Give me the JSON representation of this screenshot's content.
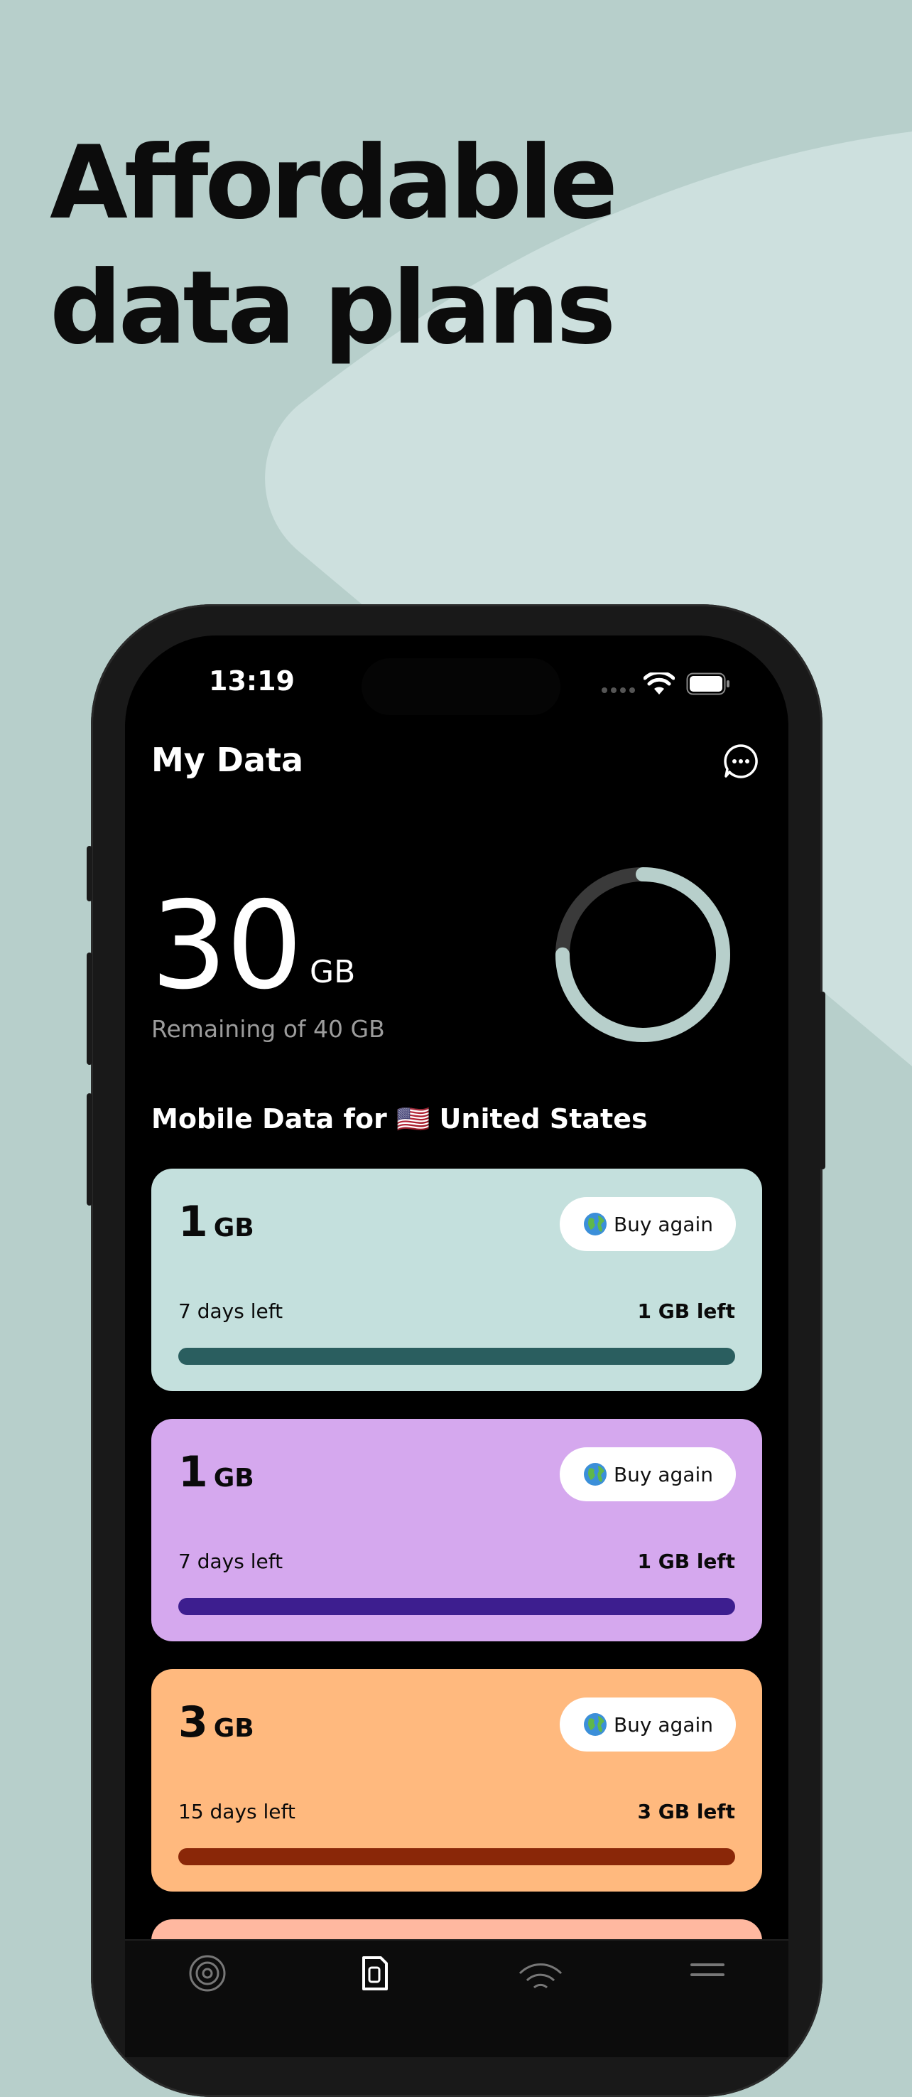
{
  "headline": [
    "Affordable",
    "data plans"
  ],
  "status_bar": {
    "time": "13:19"
  },
  "app": {
    "title": "My Data",
    "remaining_value": "30",
    "remaining_unit": "GB",
    "remaining_caption": "Remaining of 40 GB",
    "remaining_fraction": 0.75,
    "section_title": "Mobile Data for 🇺🇸 United States"
  },
  "plans": [
    {
      "amount": "1",
      "unit": "GB",
      "buy_label": "Buy again",
      "days_left": "7 days left",
      "data_left": "1 GB left",
      "progress": 1.0,
      "card_color": "#c4e0dd",
      "bar_color": "#2a5e5f"
    },
    {
      "amount": "1",
      "unit": "GB",
      "buy_label": "Buy again",
      "days_left": "7 days left",
      "data_left": "1 GB left",
      "progress": 1.0,
      "card_color": "#d5a8ee",
      "bar_color": "#3d1e8f"
    },
    {
      "amount": "3",
      "unit": "GB",
      "buy_label": "Buy again",
      "days_left": "15 days left",
      "data_left": "3 GB left",
      "progress": 1.0,
      "card_color": "#ffb97e",
      "bar_color": "#8a2708"
    }
  ],
  "colors": {
    "background": "#b7cfcb",
    "ring_fill": "#b7cfcb",
    "ring_track": "#3a3a3a",
    "fourth_card_peek": "#ffb8a0"
  },
  "icons": [
    "signal-dots-icon",
    "wifi-icon",
    "battery-icon",
    "chat-icon",
    "globe-icon",
    "tab-esim-icon",
    "tab-data-icon",
    "tab-wifi-icon",
    "tab-menu-icon"
  ]
}
